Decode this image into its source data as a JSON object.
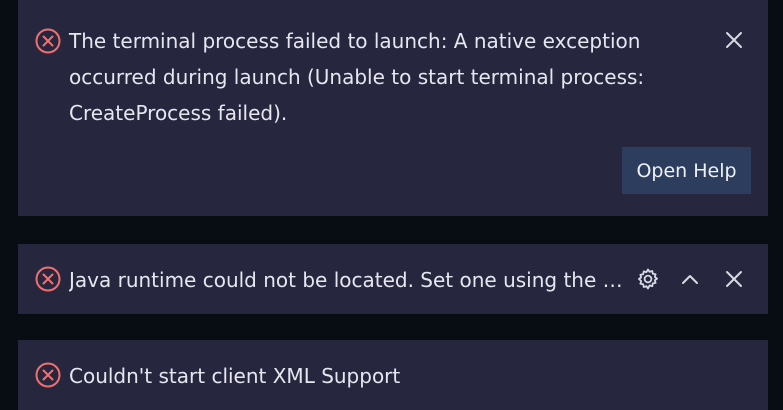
{
  "colors": {
    "background": "#080d14",
    "toast_bg": "#26273f",
    "error_icon": "#f0706e",
    "button_bg": "#2c3d5d",
    "text": "#e6e6ee"
  },
  "notifications": [
    {
      "icon": "error-circle-x-icon",
      "message": "The terminal process failed to launch: A native exception occurred during launch (Unable to start terminal process: CreateProcess failed).",
      "actions": {
        "primary_label": "Open Help"
      },
      "close_icon": "close-icon"
    },
    {
      "icon": "error-circle-x-icon",
      "message": "Java runtime could not be located. Set one using the sal...",
      "gear_icon": "gear-icon",
      "expand_icon": "chevron-up-icon",
      "close_icon": "close-icon"
    },
    {
      "icon": "error-circle-x-icon",
      "message": "Couldn't start client XML Support"
    }
  ]
}
